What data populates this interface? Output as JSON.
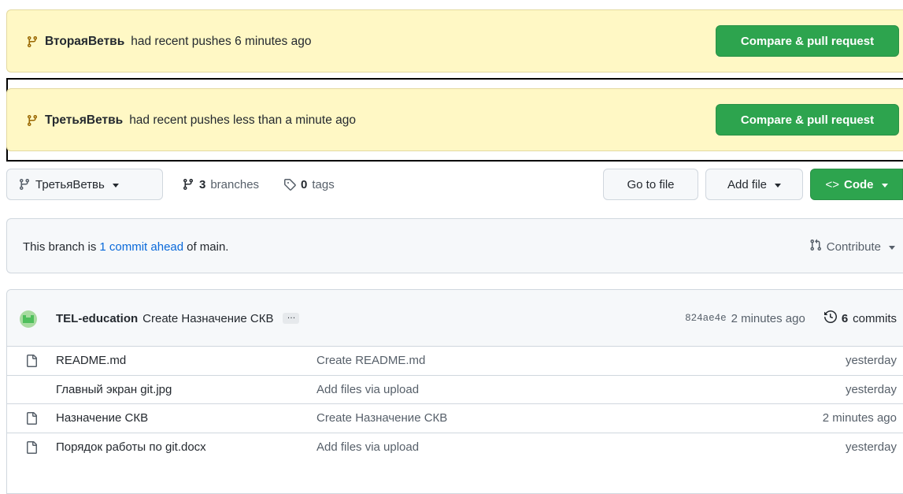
{
  "banners": [
    {
      "branch": "ВтораяВетвь",
      "text": "had recent pushes 6 minutes ago",
      "button": "Compare & pull request"
    },
    {
      "branch": "ТретьяВетвь",
      "text": "had recent pushes less than a minute ago",
      "button": "Compare & pull request"
    }
  ],
  "toolbar": {
    "branch_select": "ТретьяВетвь",
    "branches_count": "3",
    "branches_label": "branches",
    "tags_count": "0",
    "tags_label": "tags",
    "go_to_file": "Go to file",
    "add_file": "Add file",
    "code": "Code"
  },
  "ahead": {
    "prefix": "This branch is",
    "link": "1 commit ahead",
    "suffix": "of main.",
    "contribute": "Contribute"
  },
  "commit": {
    "author": "TEL-education",
    "message": "Create Назначение СКВ",
    "ellipsis": "…",
    "sha": "824ae4e",
    "age": "2 minutes ago",
    "commits_count": "6",
    "commits_label": "commits"
  },
  "files": [
    {
      "name": "README.md",
      "message": "Create README.md",
      "age": "yesterday"
    },
    {
      "name": "Главный экран git.jpg",
      "message": "Add files via upload",
      "age": "yesterday"
    },
    {
      "name": "Назначение СКВ",
      "message": "Create Назначение СКВ",
      "age": "2 minutes ago"
    },
    {
      "name": "Порядок работы по git.docx",
      "message": "Add files via upload",
      "age": "yesterday"
    }
  ],
  "colors": {
    "banner_bg": "#fff8c5",
    "primary_green": "#2da44e",
    "link_blue": "#0969da"
  }
}
